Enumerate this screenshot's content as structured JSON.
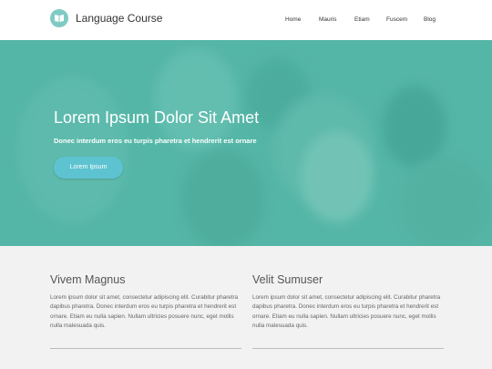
{
  "brand": {
    "name": "Language Course",
    "icon": "book-icon"
  },
  "nav": {
    "items": [
      "Home",
      "Mauris",
      "Etiam",
      "Fuscem",
      "Blog"
    ]
  },
  "hero": {
    "title": "Lorem Ipsum Dolor Sit Amet",
    "subtitle": "Donec interdum eros eu turpis pharetra et hendrerit est ornare",
    "button": "Lorem Ipsum",
    "overlay_color": "#4fb4a4"
  },
  "columns": [
    {
      "title": "Vivem Magnus",
      "text": "Lorem ipsum dolor sit amet, consectetur adipiscing elit. Curabitur pharetra dapibus pharetra. Donec interdum eros eu turpis pharetra et hendrerit est ornare. Etiam eu nulla sapien. Nullam ultricies posuere nunc, eget mollis nulla malesuada quis."
    },
    {
      "title": "Velit Sumuser",
      "text": "Lorem ipsum dolor sit amet, consectetur adipiscing elit. Curabitur pharetra dapibus pharetra. Donec interdum eros eu turpis pharetra et hendrerit est ornare. Etiam eu nulla sapien. Nullam ultricies posuere nunc, eget mollis nulla malesuada quis."
    }
  ]
}
